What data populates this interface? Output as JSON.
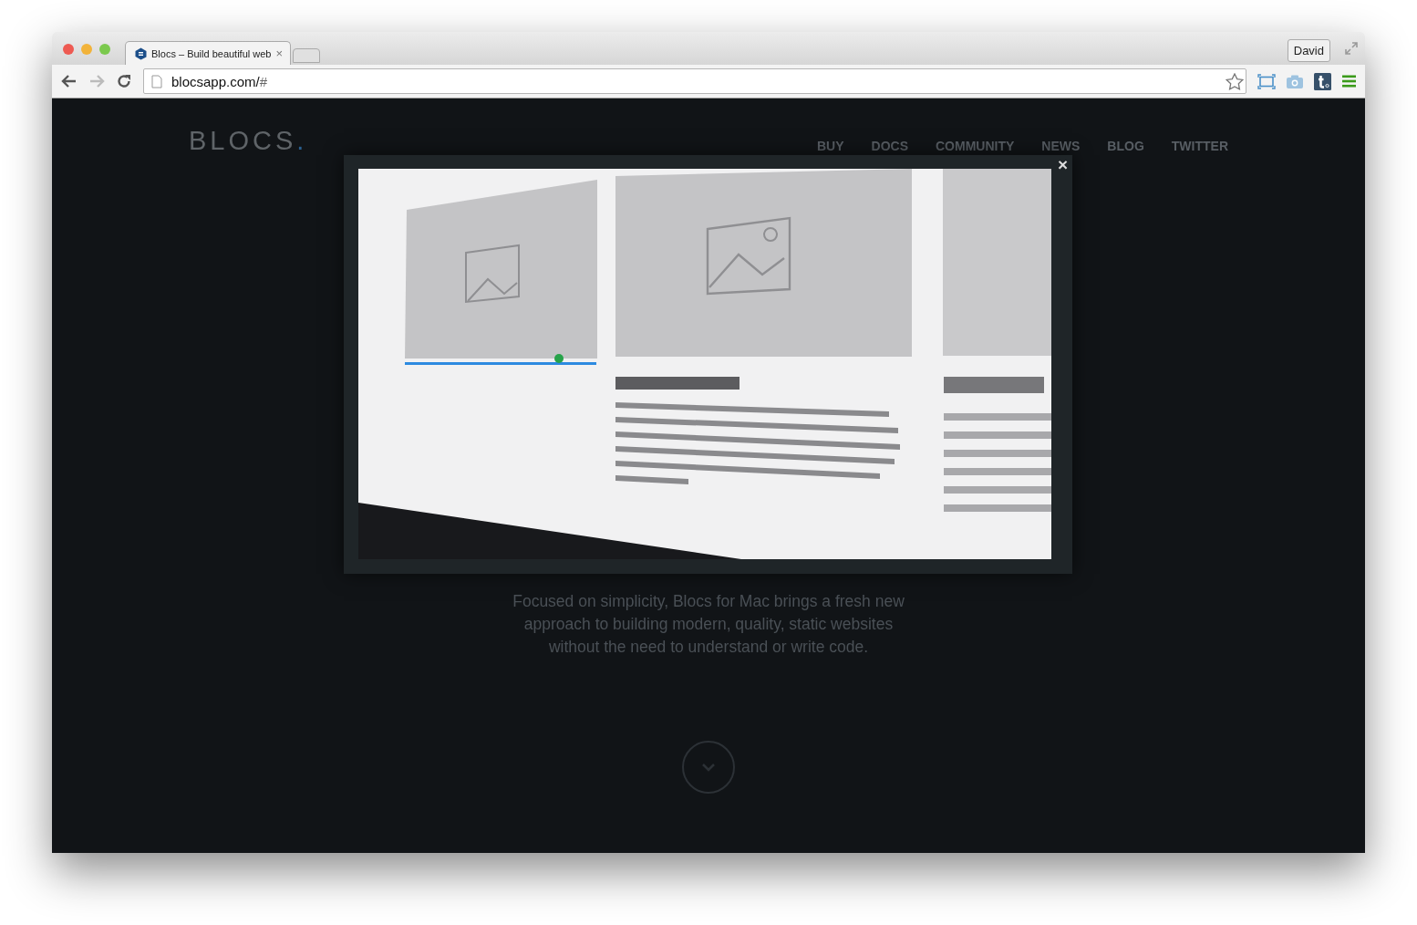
{
  "browser": {
    "tab": {
      "title": "Blocs – Build beautiful web",
      "close": "×",
      "selected": true
    },
    "address": {
      "host": "blocsapp.com/",
      "path": "#"
    },
    "profile": "David"
  },
  "page": {
    "logo": {
      "text": "BLOCS",
      "dot": "."
    },
    "nav": [
      "BUY",
      "DOCS",
      "COMMUNITY",
      "NEWS",
      "BLOG",
      "TWITTER"
    ],
    "intro": "Focused on simplicity, Blocs for Mac brings a fresh new approach to building modern, quality, static websites without the need to understand or write code."
  },
  "modal": {
    "close": "×"
  }
}
